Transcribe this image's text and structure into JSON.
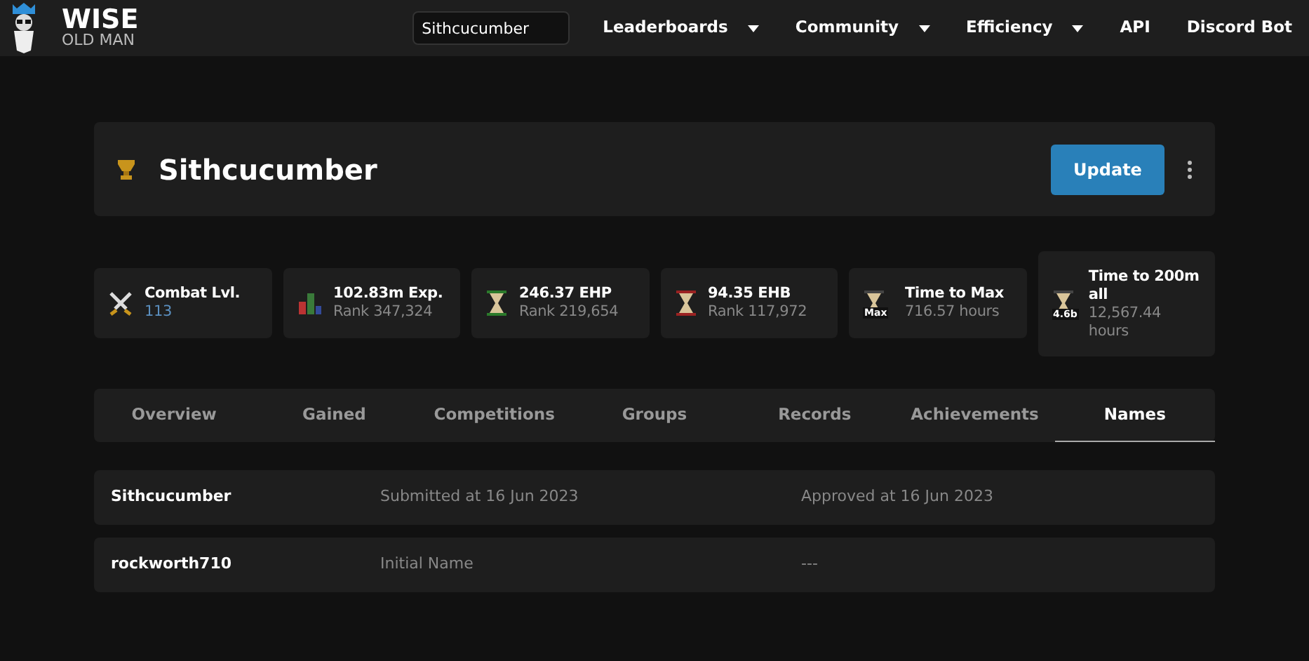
{
  "navbar": {
    "logo_title": "WISE",
    "logo_subtitle": "OLD MAN",
    "search": {
      "value": "Sithcucumber"
    },
    "links": [
      {
        "label": "Leaderboards",
        "dropdown": true
      },
      {
        "label": "Community",
        "dropdown": true
      },
      {
        "label": "Efficiency",
        "dropdown": true
      },
      {
        "label": "API",
        "dropdown": false
      },
      {
        "label": "Discord Bot",
        "dropdown": false
      }
    ]
  },
  "player": {
    "name": "Sithcucumber",
    "update_button": "Update"
  },
  "stats": [
    {
      "kind": "combat",
      "title": "Combat Lvl.",
      "subtitle": "113",
      "accent": true
    },
    {
      "kind": "exp",
      "title": "102.83m Exp.",
      "subtitle": "Rank 347,324",
      "accent": false
    },
    {
      "kind": "ehp",
      "title": "246.37 EHP",
      "subtitle": "Rank 219,654",
      "accent": false
    },
    {
      "kind": "ehb",
      "title": "94.35 EHB",
      "subtitle": "Rank 117,972",
      "accent": false
    },
    {
      "kind": "hourglass",
      "badge": "Max",
      "title": "Time to Max",
      "subtitle": "716.57 hours",
      "accent": false
    },
    {
      "kind": "hourglass",
      "badge": "4.6b",
      "title": "Time to 200m all",
      "subtitle": "12,567.44 hours",
      "accent": false
    }
  ],
  "tabs": [
    {
      "label": "Overview",
      "selected": false
    },
    {
      "label": "Gained",
      "selected": false
    },
    {
      "label": "Competitions",
      "selected": false
    },
    {
      "label": "Groups",
      "selected": false
    },
    {
      "label": "Records",
      "selected": false
    },
    {
      "label": "Achievements",
      "selected": false
    },
    {
      "label": "Names",
      "selected": true
    }
  ],
  "name_changes": [
    {
      "name": "Sithcucumber",
      "submitted": "Submitted at 16 Jun 2023",
      "approved": "Approved at 16 Jun 2023"
    },
    {
      "name": "rockworth710",
      "submitted": "Initial Name",
      "approved": "---"
    }
  ]
}
